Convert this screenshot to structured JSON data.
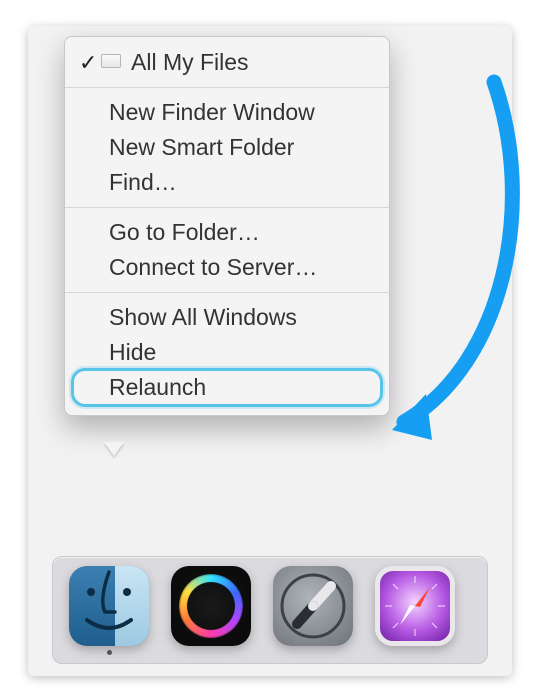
{
  "menu": {
    "header": {
      "label": "All My Files",
      "checked": true
    },
    "group1": [
      {
        "label": "New Finder Window"
      },
      {
        "label": "New Smart Folder"
      },
      {
        "label": "Find…"
      }
    ],
    "group2": [
      {
        "label": "Go to Folder…"
      },
      {
        "label": "Connect to Server…"
      }
    ],
    "group3": [
      {
        "label": "Show All Windows"
      },
      {
        "label": "Hide"
      },
      {
        "label": "Relaunch"
      }
    ],
    "highlighted_item": "Relaunch"
  },
  "dock": {
    "apps": [
      {
        "name": "Finder",
        "running": true
      },
      {
        "name": "Siri",
        "running": false
      },
      {
        "name": "Launchpad",
        "running": false
      },
      {
        "name": "Safari",
        "running": false
      }
    ]
  },
  "annotation": {
    "arrow_color": "#169ff2",
    "highlight_color": "#58c5e8"
  }
}
